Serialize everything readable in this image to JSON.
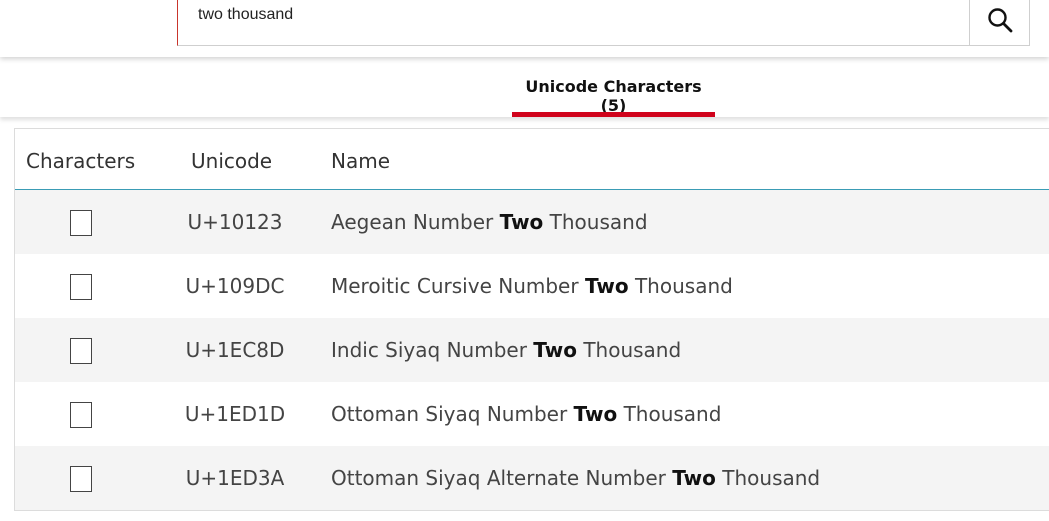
{
  "search": {
    "query": "two thousand",
    "button_icon": "search-icon"
  },
  "tabs": [
    {
      "label": "Unicode Characters (5)",
      "active": true,
      "accent_color": "#d0021b"
    }
  ],
  "table": {
    "headers": {
      "characters": "Characters",
      "unicode": "Unicode",
      "name": "Name"
    },
    "rows": [
      {
        "char_icon": "missing-glyph-icon",
        "code": "U+10123",
        "name_before": "Aegean Number",
        "name_highlight": "Two",
        "name_after": "Thousand"
      },
      {
        "char_icon": "missing-glyph-icon",
        "code": "U+109DC",
        "name_before": "Meroitic Cursive Number",
        "name_highlight": "Two",
        "name_after": "Thousand"
      },
      {
        "char_icon": "missing-glyph-icon",
        "code": "U+1EC8D",
        "name_before": "Indic Siyaq Number",
        "name_highlight": "Two",
        "name_after": "Thousand"
      },
      {
        "char_icon": "missing-glyph-icon",
        "code": "U+1ED1D",
        "name_before": "Ottoman Siyaq Number",
        "name_highlight": "Two",
        "name_after": "Thousand"
      },
      {
        "char_icon": "missing-glyph-icon",
        "code": "U+1ED3A",
        "name_before": "Ottoman Siyaq Alternate Number",
        "name_highlight": "Two",
        "name_after": "Thousand"
      }
    ]
  }
}
